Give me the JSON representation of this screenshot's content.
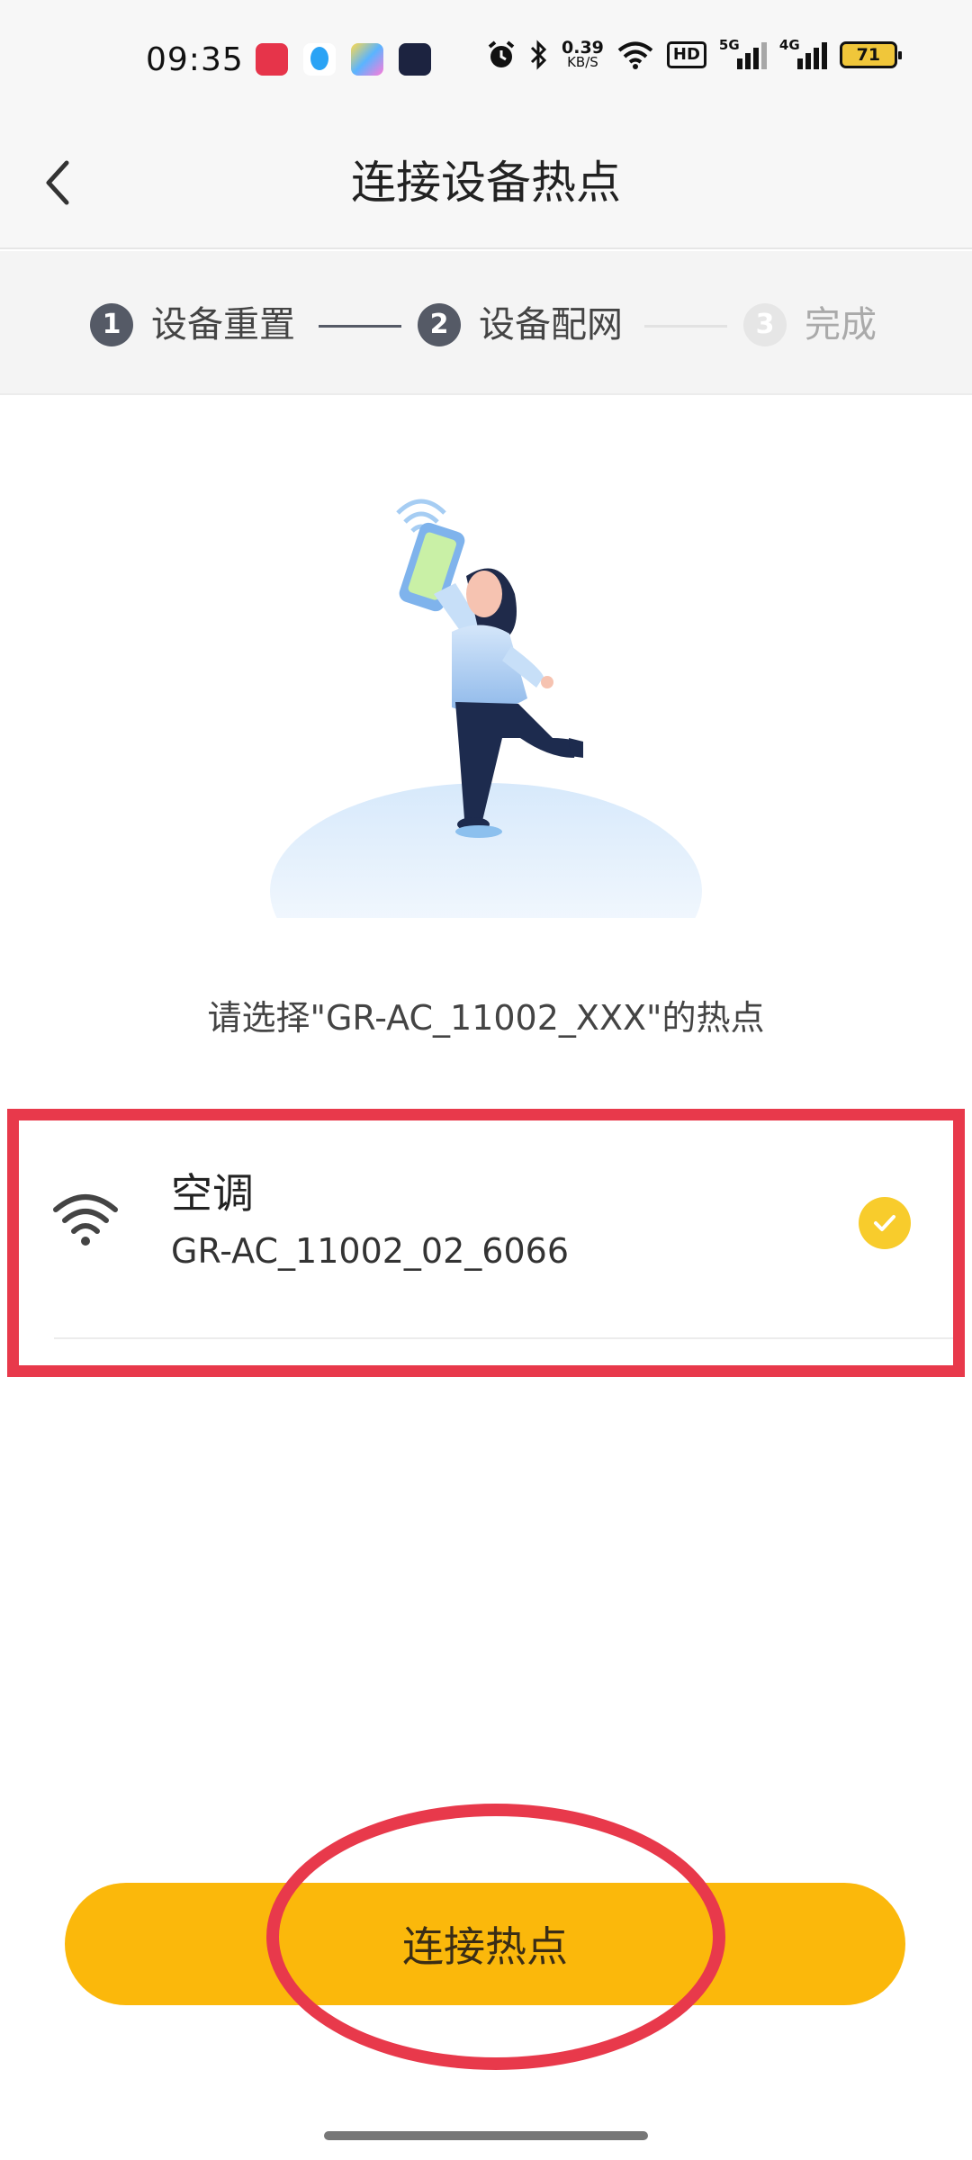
{
  "status_bar": {
    "time": "09:35",
    "net_speed_value": "0.39",
    "net_speed_unit": "KB/S",
    "hd_badge": "HD",
    "signal1_label": "5G",
    "signal2_label": "4G",
    "battery_level": "71",
    "app_icons": [
      "screen-recorder-icon",
      "qq-icon",
      "browser-icon",
      "app-icon"
    ],
    "system_icons": [
      "alarm-icon",
      "bluetooth-icon",
      "wifi-icon",
      "signal-icon",
      "battery-icon"
    ]
  },
  "header": {
    "title": "连接设备热点",
    "back_icon": "back-arrow-icon"
  },
  "steps": [
    {
      "number": "1",
      "label": "设备重置",
      "state": "done"
    },
    {
      "number": "2",
      "label": "设备配网",
      "state": "active"
    },
    {
      "number": "3",
      "label": "完成",
      "state": "pending"
    }
  ],
  "hint": "请选择\"GR-AC_11002_XXX\"的热点",
  "hotspot": {
    "name": "空调",
    "ssid": "GR-AC_11002_02_6066",
    "selected": true,
    "icon": "wifi-icon"
  },
  "connect_button": {
    "label": "连接热点"
  },
  "colors": {
    "accent": "#FBB80B",
    "check": "#F8CC2C",
    "annotation": "#E8394B",
    "step_active": "#555A66",
    "step_inactive": "#E6E6E6"
  }
}
